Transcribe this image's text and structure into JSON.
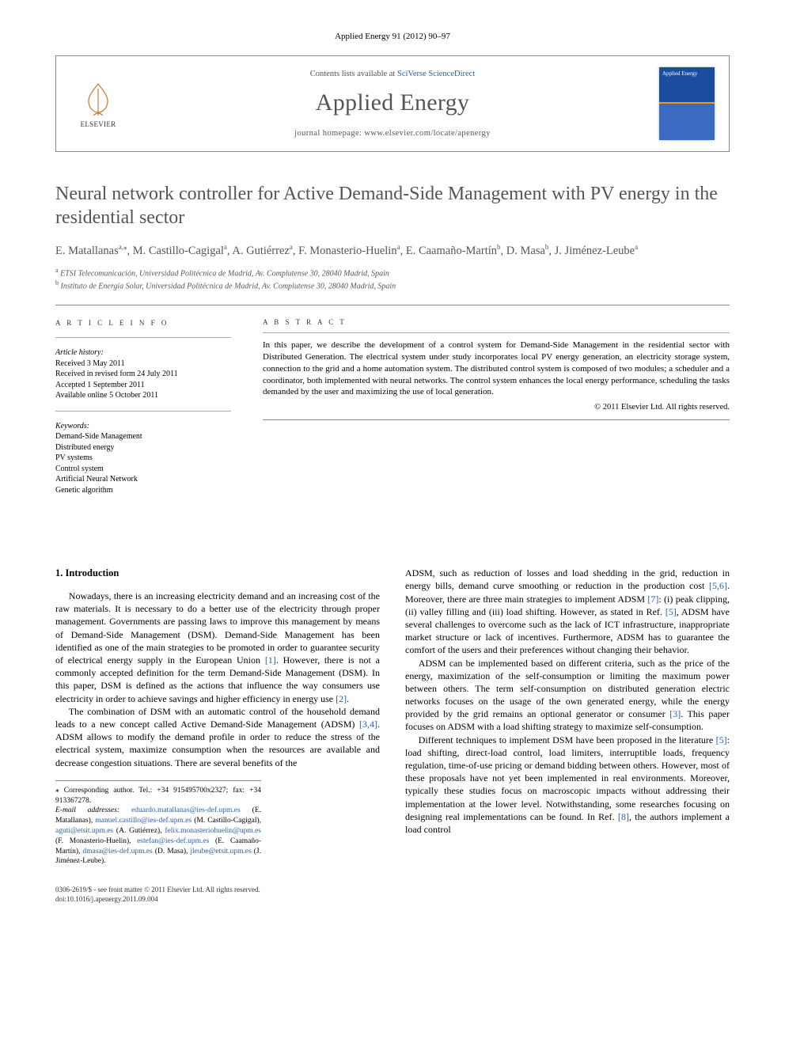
{
  "running_head": "Applied Energy 91 (2012) 90–97",
  "masthead": {
    "contents_line_pre": "Contents lists available at ",
    "contents_link": "SciVerse ScienceDirect",
    "journal_name": "Applied Energy",
    "homepage_pre": "journal homepage: ",
    "homepage_url": "www.elsevier.com/locate/apenergy",
    "publisher": "ELSEVIER",
    "cover_label": "AppliedEnergy"
  },
  "article": {
    "title": "Neural network controller for Active Demand-Side Management with PV energy in the residential sector",
    "authors_line_1": "E. Matallanas",
    "authors_aff_1": "a,",
    "authors_star": "⁎",
    "authors_line_2": ", M. Castillo-Cagigal",
    "authors_aff_2": "a",
    "authors_line_3": ", A. Gutiérrez",
    "authors_aff_3": "a",
    "authors_line_4": ", F. Monasterio-Huelin",
    "authors_aff_4": "a",
    "authors_line_5": ", E. Caamaño-Martín",
    "authors_aff_5": "b",
    "authors_line_6": ", D. Masa",
    "authors_aff_6": "b",
    "authors_line_7": ", J. Jiménez-Leube",
    "authors_aff_7": "a",
    "affiliation_a": "ETSI Telecomunicación, Universidad Politécnica de Madrid, Av. Complutense 30, 28040 Madrid, Spain",
    "affiliation_b": "Instituto de Energía Solar, Universidad Politécnica de Madrid, Av. Complutense 30, 28040 Madrid, Spain"
  },
  "article_info": {
    "head": "A R T I C L E   I N F O",
    "history_label": "Article history:",
    "received": "Received 3 May 2011",
    "revised": "Received in revised form 24 July 2011",
    "accepted": "Accepted 1 September 2011",
    "online": "Available online 5 October 2011",
    "keywords_label": "Keywords:",
    "keywords": [
      "Demand-Side Management",
      "Distributed energy",
      "PV systems",
      "Control system",
      "Artificial Neural Network",
      "Genetic algorithm"
    ]
  },
  "abstract": {
    "head": "A B S T R A C T",
    "text": "In this paper, we describe the development of a control system for Demand-Side Management in the residential sector with Distributed Generation. The electrical system under study incorporates local PV energy generation, an electricity storage system, connection to the grid and a home automation system. The distributed control system is composed of two modules; a scheduler and a coordinator, both implemented with neural networks. The control system enhances the local energy performance, scheduling the tasks demanded by the user and maximizing the use of local generation.",
    "copyright": "© 2011 Elsevier Ltd. All rights reserved."
  },
  "body": {
    "heading_1": "1. Introduction",
    "p1": "Nowadays, there is an increasing electricity demand and an increasing cost of the raw materials. It is necessary to do a better use of the electricity through proper management. Governments are passing laws to improve this management by means of Demand-Side Management (DSM). Demand-Side Management has been identified as one of the main strategies to be promoted in order to guarantee security of electrical energy supply in the European Union ",
    "ref1": "[1]",
    "p1b": ". However, there is not a commonly accepted definition for the term Demand-Side Management (DSM). In this paper, DSM is defined as the actions that influence the way consumers use electricity in order to achieve savings and higher efficiency in energy use ",
    "ref2": "[2]",
    "p1c": ".",
    "p2": "The combination of DSM with an automatic control of the household demand leads to a new concept called Active Demand-Side Management (ADSM) ",
    "ref34": "[3,4]",
    "p2b": ". ADSM allows to modify the demand profile in order to reduce the stress of the electrical system, maximize consumption when the resources are available and decrease congestion situations. There are several benefits of the",
    "p3": "ADSM, such as reduction of losses and load shedding in the grid, reduction in energy bills, demand curve smoothing or reduction in the production cost ",
    "ref56": "[5,6]",
    "p3b": ". Moreover, there are three main strategies to implement ADSM ",
    "ref7": "[7]",
    "p3c": ": (i) peak clipping, (ii) valley filling and (iii) load shifting. However, as stated in Ref. ",
    "ref5": "[5]",
    "p3d": ", ADSM have several challenges to overcome such as the lack of ICT infrastructure, inappropriate market structure or lack of incentives. Furthermore, ADSM has to guarantee the comfort of the users and their preferences without changing their behavior.",
    "p4": "ADSM can be implemented based on different criteria, such as the price of the energy, maximization of the self-consumption or limiting the maximum power between others. The term self-consumption on distributed generation electric networks focuses on the usage of the own generated energy, while the energy provided by the grid remains an optional generator or consumer ",
    "ref3": "[3]",
    "p4b": ". This paper focuses on ADSM with a load shifting strategy to maximize self-consumption.",
    "p5": "Different techniques to implement DSM have been proposed in the literature ",
    "ref5b": "[5]",
    "p5b": ": load shifting, direct-load control, load limiters, interruptible loads, frequency regulation, time-of-use pricing or demand bidding between others. However, most of these proposals have not yet been implemented in real environments. Moreover, typically these studies focus on macroscopic impacts without addressing their implementation at the lower level. Notwithstanding, some researches focusing on designing real implementations can be found. In Ref. ",
    "ref8": "[8]",
    "p5c": ", the authors implement a load control"
  },
  "footnotes": {
    "corr_author": "⁎ Corresponding author. Tel.: +34 915495700x2327; fax: +34 913367278.",
    "email_label": "E-mail addresses: ",
    "emails": [
      {
        "addr": "eduardo.matallanas@ies-def.upm.es",
        "name": " (E. Matallanas), "
      },
      {
        "addr": "manuel.castillo@ies-def.upm.es",
        "name": " (M. Castillo-Cagigal), "
      },
      {
        "addr": "aguti@etsit.upm.es",
        "name": " (A. Gutiérrez), "
      },
      {
        "addr": "felix.monasteriohuelin@upm.es",
        "name": " (F. Monasterio-Huelin), "
      },
      {
        "addr": "estefan@ies-def.upm.es",
        "name": " (E. Caamaño-Martín), "
      },
      {
        "addr": "dmasa@ies-def.upm.es",
        "name": " (D. Masa), "
      },
      {
        "addr": "jleube@etsit.upm.es",
        "name": " (J. Jiménez-Leube)."
      }
    ]
  },
  "footer": {
    "line1": "0306-2619/$ - see front matter © 2011 Elsevier Ltd. All rights reserved.",
    "line2": "doi:10.1016/j.apenergy.2011.09.004"
  }
}
